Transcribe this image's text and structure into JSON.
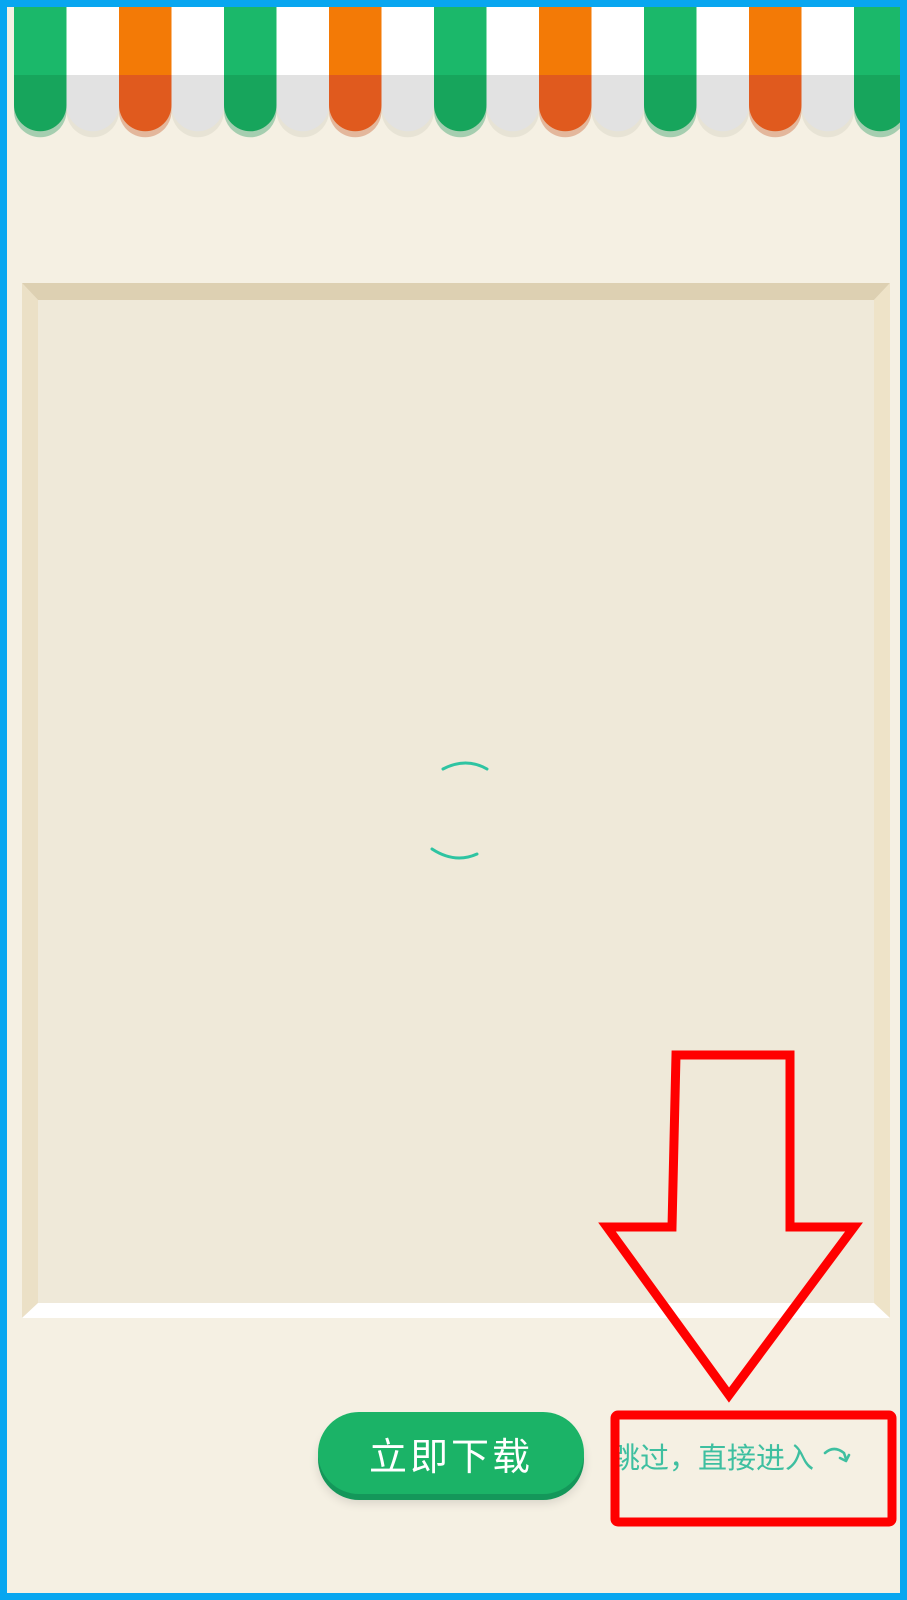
{
  "colors": {
    "background": "#f5f0e3",
    "border": "#08a6f0",
    "stripe_green": "#1bb86a",
    "stripe_orange": "#f37a06",
    "stripe_white": "#ffffff",
    "button": "#1bb367",
    "skip_text": "#3ebfa0",
    "annotation": "#ff0000"
  },
  "actions": {
    "download_label": "立即下载",
    "skip_label": "跳过，直接进入"
  },
  "icons": {
    "awning": "striped-awning-icon",
    "spinner": "loading-spinner-icon",
    "skip_arrow": "curved-arrow-icon",
    "annotation_arrow": "down-arrow-annotation"
  }
}
